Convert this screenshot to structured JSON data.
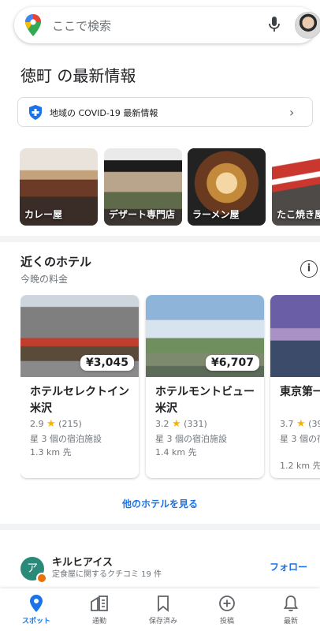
{
  "search": {
    "placeholder": "ここで検索"
  },
  "section_title": "徳町 の最新情報",
  "covid_banner": {
    "label": "地域の COVID-19 最新情報"
  },
  "categories": [
    {
      "label": "カレー屋"
    },
    {
      "label": "デザート専門店"
    },
    {
      "label": "ラーメン屋"
    },
    {
      "label": "たこ焼き屋"
    }
  ],
  "hotels_section": {
    "title": "近くのホテル",
    "subtitle": "今晩の料金",
    "more_link": "他のホテルを見る",
    "hotels": [
      {
        "name": "ホテルセレクトイン米沢",
        "price": "¥3,045",
        "rating": "2.9",
        "reviews": "(215)",
        "class": "星 3 個の宿泊施設",
        "distance": "1.3 km 先"
      },
      {
        "name": "ホテルモントビュー米沢",
        "price": "¥6,707",
        "rating": "3.2",
        "reviews": "(331)",
        "class": "星 3 個の宿泊施設",
        "distance": "1.4 km 先"
      },
      {
        "name": "東京第一ホテル米沢",
        "price": "",
        "rating": "3.7",
        "reviews": "(39",
        "class": "星 3 個の宿",
        "distance": "1.2 km 先"
      }
    ]
  },
  "review_user": {
    "initial": "ア",
    "name": "キルヒアイス",
    "meta": "定食屋に関するクチコミ 19 件",
    "follow_label": "フォロー"
  },
  "bottom_nav": [
    {
      "label": "スポット",
      "icon": "location-pin-icon",
      "active": true
    },
    {
      "label": "通勤",
      "icon": "commute-icon",
      "active": false
    },
    {
      "label": "保存済み",
      "icon": "bookmark-icon",
      "active": false
    },
    {
      "label": "投稿",
      "icon": "add-circle-icon",
      "active": false
    },
    {
      "label": "最新",
      "icon": "bell-icon",
      "active": false
    }
  ],
  "colors": {
    "accent": "#1a73e8",
    "star": "#f4b400"
  }
}
